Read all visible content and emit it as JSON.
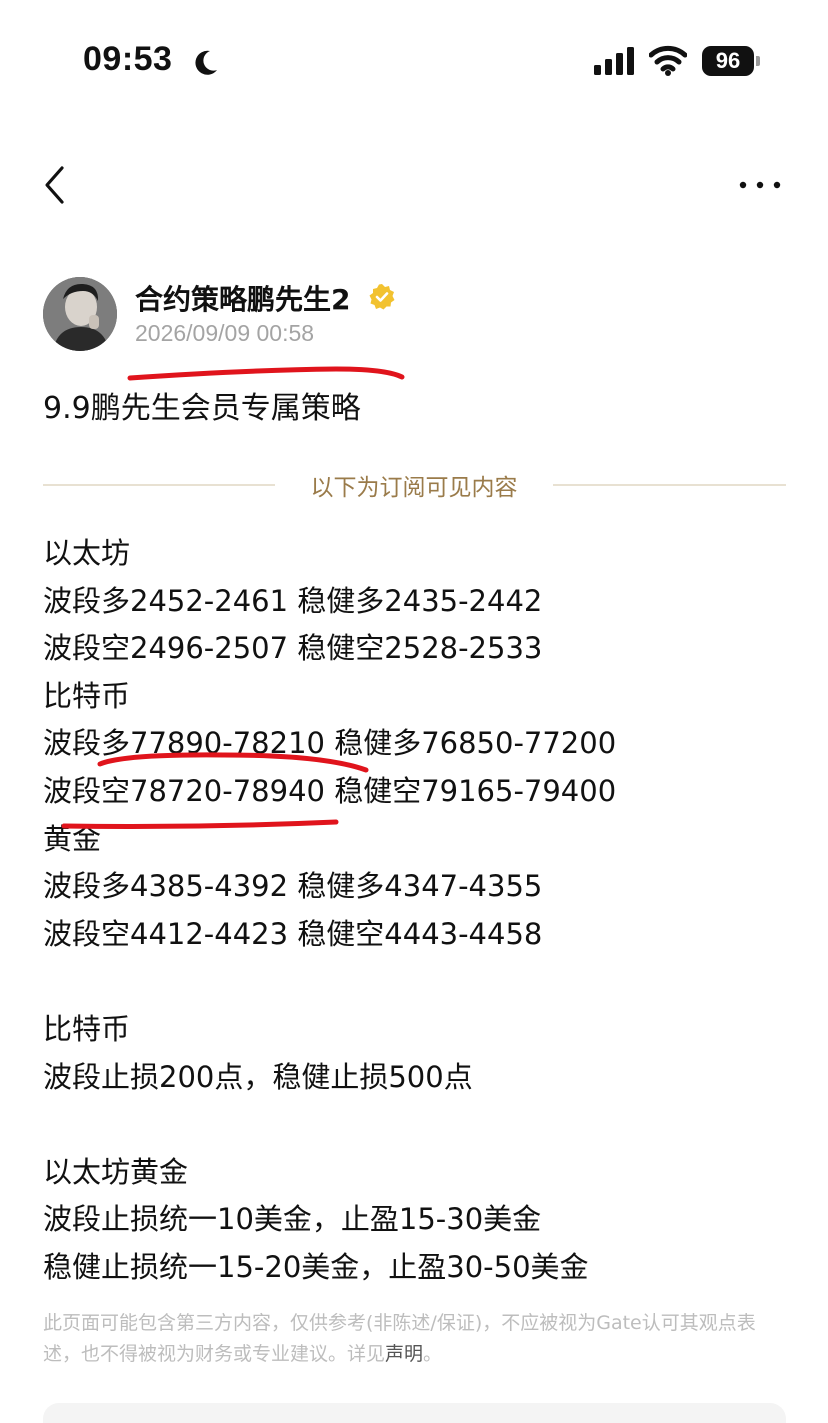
{
  "status_bar": {
    "time": "09:53",
    "battery": "96"
  },
  "icons": {
    "moon": "moon-icon",
    "signal": "cellular-signal-icon",
    "wifi": "wifi-icon",
    "back": "chevron-left-icon",
    "more": "more-dots-icon",
    "verified": "verified-badge-icon"
  },
  "colors": {
    "divider_label": "#9a7b4a",
    "divider_line": "#e8e1d2",
    "verified_badge": "#f2c230",
    "annotation_red": "#e0141c",
    "timestamp": "#a4a4a4",
    "disclaimer": "#bdbdbd"
  },
  "author": {
    "name": "合约策略鹏先生2",
    "time": "2026/09/09 00:58"
  },
  "post": {
    "title": "9.9鹏先生会员专属策略",
    "divider_label": "以下为订阅可见内容",
    "lines": [
      "以太坊",
      "波段多2452-2461 稳健多2435-2442",
      "波段空2496-2507 稳健空2528-2533",
      "比特币",
      "波段多77890-78210 稳健多76850-77200",
      "波段空78720-78940 稳健空79165-79400",
      "黄金",
      "波段多4385-4392 稳健多4347-4355",
      "波段空4412-4423 稳健空4443-4458",
      "",
      "比特币",
      "波段止损200点，稳健止损500点",
      "",
      "以太坊黄金",
      "波段止损统一10美金，止盈15-30美金",
      "稳健止损统一15-20美金，止盈30-50美金"
    ]
  },
  "disclaimer": {
    "text": "此页面可能包含第三方内容，仅供参考(非陈述/保证)，不应被视为Gate认可其观点表述，也不得被视为财务或专业建议。详见",
    "link": "声明",
    "suffix": "。"
  }
}
